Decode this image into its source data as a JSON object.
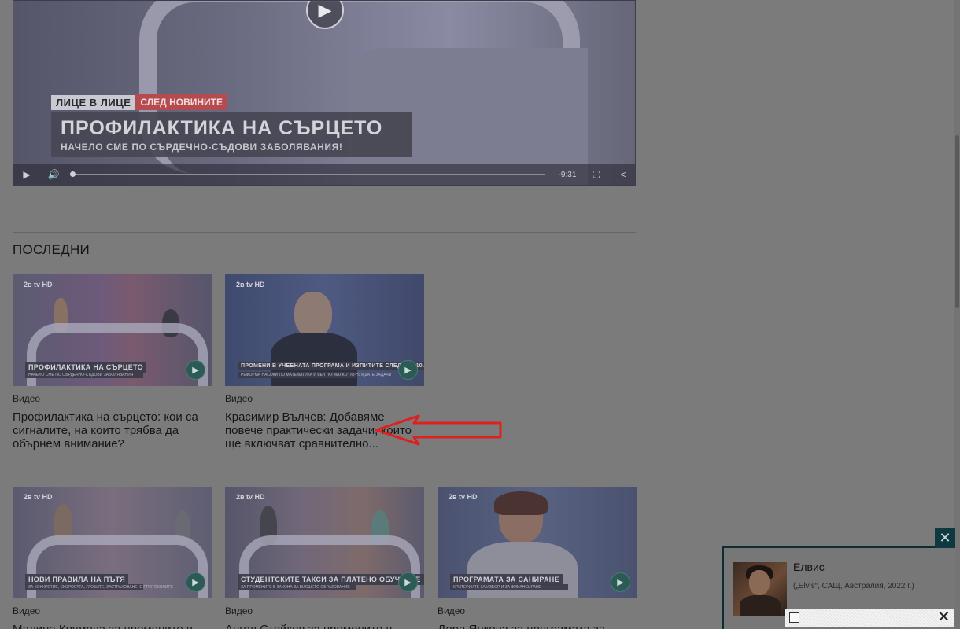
{
  "player": {
    "show_tag_a": "ЛИЦЕ В ЛИЦЕ",
    "show_tag_b": "СЛЕД НОВИНИТЕ",
    "title": "ПРОФИЛАКТИКА НА СЪРЦЕТО",
    "subtitle": "НАЧЕЛО СМЕ ПО СЪРДЕЧНО-СЪДОВИ ЗАБОЛЯВАНИЯ!",
    "time": "-9:31",
    "play_icon": "▶",
    "volume_icon": "🔊",
    "fullscreen_icon": "⛶",
    "share_icon": "<"
  },
  "section_title": "ПОСЛЕДНИ",
  "cards": [
    {
      "category": "Видео",
      "headline": "Профилактика на сърцето: кои са сигналите, на които трябва да обърнем внимание?",
      "caption": "ПРОФИЛАКТИКА НА СЪРЦЕТО",
      "caption_sub": "НАЧЕЛО СМЕ ПО СЪРДЕЧНО-СЪДОВИ ЗАБОЛЯВАНИЯ",
      "logo": "2ʙ tv HD"
    },
    {
      "category": "Видео",
      "headline": "Красимир Вълчев: Добавяме повече практически задачи, които ще включват сравнително...",
      "caption": "ПРОМЕНИ В УЧЕБНАТА ПРОГРАМА И ИЗПИТИТЕ СЛЕД 7. И 10. КЛАС",
      "caption_sub": "РЕФОРМА НАСОКИ ПО МАТЕМАТИКА И БЕЛ ПО-МАЛКО ПО-НУЖДАТЕ ЗАДАЧИ",
      "logo": "2ʙ tv HD"
    },
    {
      "category": "Видео",
      "headline": "Малина Крумова за промените в",
      "caption": "НОВИ ПРАВИЛА НА ПЪТЯ",
      "caption_sub": "ЗА КОНКРЕТИЕ, СКОРОСТТА, ГЛОБИТЕ, ЗАСТРАХОВАНЕ, Е-ПРОТОКОЛИТЕ",
      "logo": "2ʙ tv HD"
    },
    {
      "category": "Видео",
      "headline": "Ангел Стойков за промените в",
      "caption": "СТУДЕНТСКИТЕ ТАКСИ ЗА ПЛАТЕНО ОБУЧЕНИЕ",
      "caption_sub": "ЗА ПРОМЕНИТЕ В ЗАКОНА ЗА ВИСШЕТО ОБРАЗОВАНИЕ",
      "logo": "2ʙ tv HD"
    },
    {
      "category": "Видео",
      "headline": "Дора Янкова за програмата за",
      "caption": "ПРОГРАМАТА ЗА САНИРАНЕ",
      "caption_sub": "КРИТЕРИИТЕ ЗА ИЗБОР И ЗА ФИНАНСИРАНЕ",
      "logo": "2ʙ tv HD"
    }
  ],
  "mini_player": {
    "title": "Елвис",
    "subtitle": "(„Elvis“, САЩ, Австралия, 2022 г.)",
    "close_icon": "✕"
  },
  "ad_bar": {
    "close_icon": "✕"
  },
  "colors": {
    "overlay": "#7b7b7b",
    "mini_border": "#0c2e33",
    "play_button": "#2c5b55",
    "arrow": "#e01f1f"
  }
}
